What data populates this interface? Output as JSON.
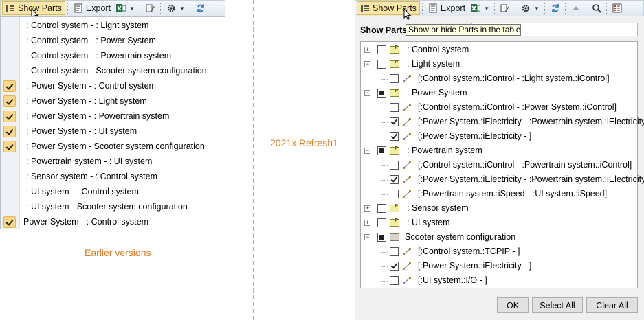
{
  "toolbar": {
    "show_parts_label": "Show Parts",
    "export_label": "Export"
  },
  "left_menu": {
    "items": [
      {
        "label": ": Control system -  : Light system",
        "checked": false
      },
      {
        "label": ": Control system -  : Power System",
        "checked": false
      },
      {
        "label": ": Control system -  : Powertrain system",
        "checked": false
      },
      {
        "label": ": Control system - Scooter system configuration",
        "checked": false
      },
      {
        "label": ": Power System -  : Control system",
        "checked": true
      },
      {
        "label": ": Power System -  : Light system",
        "checked": true
      },
      {
        "label": ": Power System -  : Powertrain system",
        "checked": true
      },
      {
        "label": ": Power System -  : UI system",
        "checked": true
      },
      {
        "label": ": Power System - Scooter system configuration",
        "checked": true
      },
      {
        "label": ": Powertrain system -  : UI system",
        "checked": false
      },
      {
        "label": ": Sensor system -  : Control system",
        "checked": false
      },
      {
        "label": ": UI system -  : Control system",
        "checked": false
      },
      {
        "label": ": UI system - Scooter system configuration",
        "checked": false
      },
      {
        "label": "Power System -  : Control system",
        "checked": true
      }
    ]
  },
  "captions": {
    "earlier": "Earlier versions",
    "version": "2021x Refresh1"
  },
  "dialog": {
    "show_parts_label": "Show Parts:",
    "tooltip": "Show or hide Parts in the table",
    "ok_label": "OK",
    "select_all_label": "Select All",
    "clear_all_label": "Clear All",
    "tree": [
      {
        "level": 0,
        "kind": "part",
        "expander": "+",
        "state": "unchecked",
        "label": ": Control system"
      },
      {
        "level": 0,
        "kind": "part",
        "expander": "-",
        "state": "unchecked",
        "label": ": Light system"
      },
      {
        "level": 1,
        "kind": "connector",
        "state": "unchecked",
        "label": "[:Control system.:iControl - :Light system.:iControl]"
      },
      {
        "level": 0,
        "kind": "part",
        "expander": "-",
        "state": "partial",
        "label": ": Power System"
      },
      {
        "level": 1,
        "kind": "connector",
        "state": "unchecked",
        "label": "[:Control system.:iControl - :Power System.:iControl]"
      },
      {
        "level": 1,
        "kind": "connector",
        "state": "checked",
        "label": "[:Power System.:iElectricity - :Powertrain system.:iElectricity]"
      },
      {
        "level": 1,
        "kind": "connector",
        "state": "checked",
        "label": "[:Power System.:iElectricity - ]"
      },
      {
        "level": 0,
        "kind": "part",
        "expander": "-",
        "state": "partial",
        "label": ": Powertrain system"
      },
      {
        "level": 1,
        "kind": "connector",
        "state": "unchecked",
        "label": "[:Control system.:iControl - :Powertrain system.:iControl]"
      },
      {
        "level": 1,
        "kind": "connector",
        "state": "checked",
        "label": "[:Power System.:iElectricity - :Powertrain system.:iElectricity]"
      },
      {
        "level": 1,
        "kind": "connector",
        "state": "unchecked",
        "label": "[:Powertrain system.:iSpeed - :UI system.:iSpeed]"
      },
      {
        "level": 0,
        "kind": "part",
        "expander": "+",
        "state": "unchecked",
        "label": ": Sensor system"
      },
      {
        "level": 0,
        "kind": "part",
        "expander": "+",
        "state": "unchecked",
        "label": ": UI system"
      },
      {
        "level": 0,
        "kind": "config",
        "expander": "-",
        "state": "partial",
        "label": "Scooter system configuration"
      },
      {
        "level": 1,
        "kind": "connector",
        "state": "unchecked",
        "label": "[:Control system.:TCPIP - ]"
      },
      {
        "level": 1,
        "kind": "connector",
        "state": "checked",
        "label": "[:Power System.:iElectricity - ]"
      },
      {
        "level": 1,
        "kind": "connector",
        "state": "unchecked",
        "label": "[:UI system.:I/O - ]"
      }
    ]
  },
  "colors": {
    "accent_caption": "#e07a1f",
    "check_highlight": "#fbd989"
  }
}
